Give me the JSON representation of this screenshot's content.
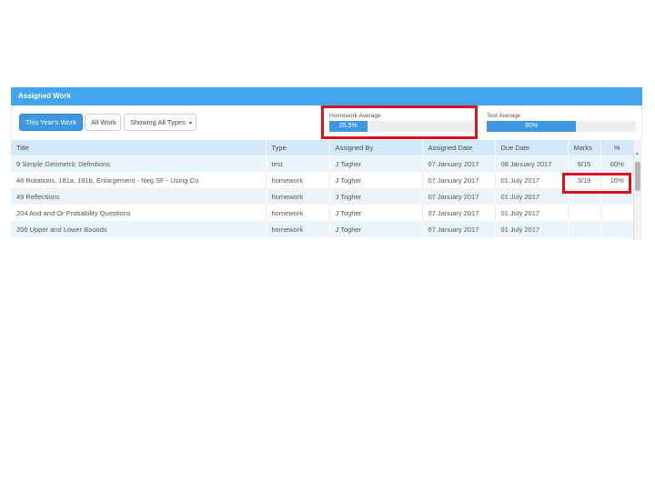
{
  "panel": {
    "title": "Assigned Work",
    "buttons": {
      "this_year": "This Year's Work",
      "all_work": "All Work",
      "types_filter": "Showing All Types",
      "types_caret": "▾"
    },
    "homework_average": {
      "label": "Homework Average",
      "value_text": "25.5%",
      "value": 25.5
    },
    "test_average": {
      "label": "Test Average",
      "value_text": "60%",
      "value": 60
    }
  },
  "table": {
    "headers": [
      "Title",
      "Type",
      "Assigned By",
      "Assigned Date",
      "Due Date",
      "Marks",
      "%"
    ],
    "rows": [
      [
        "9 Simple Geometric Definitions",
        "test",
        "J Togher",
        "07 January 2017",
        "08 January 2017",
        "9/15",
        "60%"
      ],
      [
        "46 Rotations, 181a, 181b, Enlargement - Neg.SF - Using Co",
        "homework",
        "J Togher",
        "07 January 2017",
        "01 July 2017",
        "3/19",
        "16%"
      ],
      [
        "49 Reflections",
        "homework",
        "J Togher",
        "07 January 2017",
        "01 July 2017",
        "",
        ""
      ],
      [
        "204 And and Or Probability Questions",
        "homework",
        "J Togher",
        "07 January 2017",
        "01 July 2017",
        "",
        ""
      ],
      [
        "206 Upper and Lower Bounds",
        "homework",
        "J Togher",
        "07 January 2017",
        "01 July 2017",
        "",
        ""
      ]
    ]
  },
  "colors": {
    "header_blue": "#42a5ee",
    "primary_button": "#3d97e3",
    "table_header": "#d3e9fb",
    "row_stripe": "#eaf4fd",
    "highlight_red": "#d6141d"
  }
}
